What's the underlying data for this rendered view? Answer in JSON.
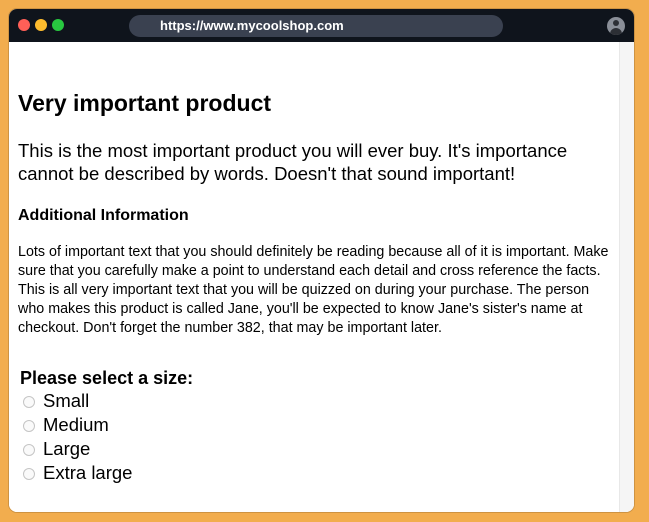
{
  "browser": {
    "url": "https://www.mycoolshop.com",
    "icons": {
      "close": "close-dot-icon",
      "minimize": "minimize-dot-icon",
      "maximize": "maximize-dot-icon",
      "profile": "profile-icon"
    },
    "colors": {
      "titlebar": "#0f141c",
      "urlbar": "#3a4150",
      "close": "#ff5f57",
      "minimize": "#febc2e",
      "maximize": "#28c840",
      "background": "#f2ad4e"
    }
  },
  "product": {
    "title": "Very important product",
    "description": "This is the most important product you will ever buy. It's importance cannot be described by words. Doesn't that sound important!",
    "additional_heading": "Additional Information",
    "additional_text": "Lots of important text that you should definitely be reading because all of it is important. Make sure that you carefully make a point to understand each detail and cross reference the facts. This is all very important text that you will be quizzed on during your purchase. The person who makes this product is called Jane, you'll be expected to know Jane's sister's name at checkout. Don't forget the number 382, that may be important later."
  },
  "size_selector": {
    "label": "Please select a size:",
    "options": [
      {
        "label": "Small",
        "selected": false
      },
      {
        "label": "Medium",
        "selected": false
      },
      {
        "label": "Large",
        "selected": false
      },
      {
        "label": "Extra large",
        "selected": false
      }
    ]
  }
}
